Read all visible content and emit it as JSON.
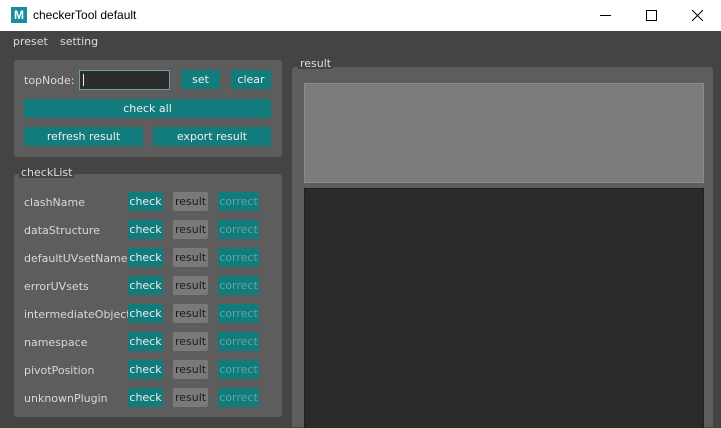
{
  "window": {
    "icon_letter": "M",
    "title": "checkerTool  default",
    "minimize_icon": "minimize-icon",
    "maximize_icon": "maximize-icon",
    "close_icon": "close-icon"
  },
  "menu": {
    "preset": "preset",
    "setting": "setting"
  },
  "top_panel": {
    "topnode_label": "topNode:",
    "topnode_value": "",
    "set_label": "set",
    "clear_label": "clear",
    "check_all_label": "check all",
    "refresh_label": "refresh result",
    "export_label": "export result"
  },
  "checklist": {
    "title": "checkList",
    "check_label": "check",
    "result_label": "result",
    "correct_label": "correct",
    "items": [
      "clashName",
      "dataStructure",
      "defaultUVsetName",
      "errorUVsets",
      "intermediateObject",
      "namespace",
      "pivotPosition",
      "unknownPlugin"
    ]
  },
  "result_panel": {
    "title": "result"
  },
  "colors": {
    "teal": "#127b7b",
    "panel": "#5d5d5d",
    "background": "#444444"
  }
}
